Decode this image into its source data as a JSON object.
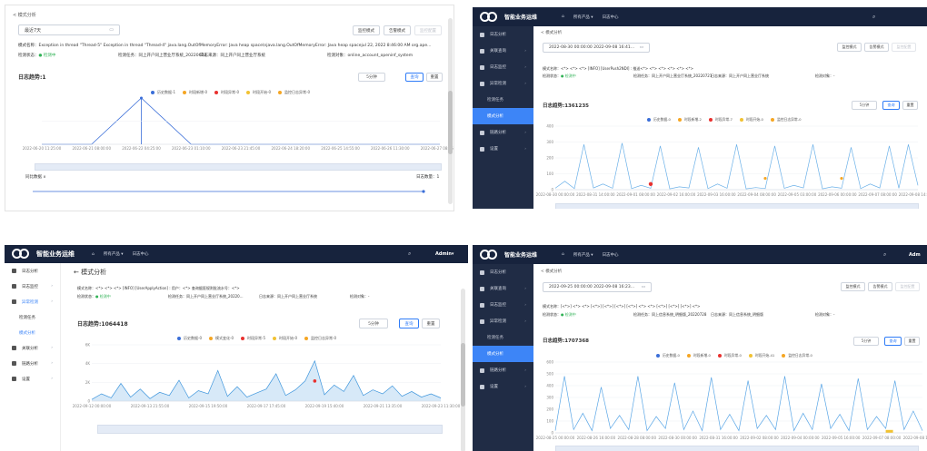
{
  "colors": {
    "bar": "#17233d",
    "side": "#202c45",
    "active": "#3d85f7",
    "line": "#6ab0e8",
    "red": "#e8312f",
    "orange": "#f5a623",
    "lineDark": "#3a8ee6"
  },
  "t1": {
    "back": "< 模式分析",
    "range": "最近7天",
    "btn_mode": "监控模式",
    "btn_err": "告警模式",
    "btn_dis": "监控配置",
    "line1": "模式名称：Exception in thread \"Thread-5\" Exception in thread \"Thread-4\" java.lang.OutOfMemoryError: Java heap space\\njava.lang.OutOfMemoryError: Java heap spacejul 22, 2022 8:46:00 AM org.ape...",
    "line2_status_label": "检测状态：",
    "line2_status": "● 检测中",
    "line2_task": "检测任务：同上开户同上营业厅系统_20220618",
    "line2_src": "日志来源：同上开户同上营业厅系统",
    "line2_db": "检测对象：online_account_openinf_system",
    "count": "日志趋势:1",
    "select": "5分钟",
    "btn_query": "查询",
    "btn_reset": "重置",
    "legend": [
      "历史数据-1",
      "时段新增-0",
      "时段异常-0",
      "时段开始-0",
      "监控日志异常-0"
    ],
    "axis_label": "同比数据 ∧",
    "count2": "日志数量：1",
    "chart_data": {
      "type": "line",
      "x": [
        "2022-06-20 11:25:00",
        "2022-06-21 08:00:00",
        "2022-06-22 04:25:00",
        "2022-06-23 01:10:00",
        "2022-06-23 21:45:00",
        "2022-06-24 18:20:00",
        "2022-06-25 14:55:00",
        "2022-06-26 11:30:00",
        "2022-06-27 08:05:00"
      ],
      "series": [
        {
          "values": [
            0,
            0,
            1,
            0,
            0,
            0,
            0,
            0,
            0
          ]
        }
      ],
      "ylim": [
        0,
        1
      ]
    }
  },
  "t2": {
    "app": "智能业务运维",
    "nav_product": "所有产品 ▾",
    "nav_center": "日志中心",
    "side": [
      "日志分析",
      "关联查询",
      "日志监控",
      "异常检测",
      "检测任务",
      "模式分析",
      "链路分析",
      "设置"
    ],
    "back": "< 模式分析",
    "range": "2022-08-30 00:00:00 2022-09-08 16:41...",
    "btn_mode": "监控模式",
    "btn_err": "告警模式",
    "btn_dis": "监控配置",
    "line1": "模式名称：<*> <*> <*> [INFO] [UserPush2NDI] : 推送<*> <*> <*> <*> <*> <*>",
    "line2_status_label": "检测状态：",
    "line2_status": "● 检测中",
    "line2_task": "检测任务：同上开户同上营业厅系统_20220721",
    "line2_src": "日志来源：同上开户同上营业厅系统",
    "line2_db": "检测对象：-",
    "count": "日志趋势:1361235",
    "select": "5分钟",
    "btn_query": "查询",
    "btn_reset": "重置",
    "legend": [
      "历史数据-0",
      "时段新增-2",
      "时段异常-7",
      "时段开始-0",
      "监控日志异常-0"
    ],
    "chart_data": {
      "type": "line",
      "y_ticks": [
        "400",
        "300",
        "200",
        "100",
        "0"
      ],
      "x_ticks": [
        "2022-08-30 00:00:00",
        "2022-08-31 14:00:00",
        "2022-09-01 08:00:00",
        "2022-09-02 16:00:00",
        "2022-09-03 16:00:00",
        "2022-09-04 08:00:00",
        "2022-09-05 03:00:00",
        "2022-09-06 00:00:00",
        "2022-09-07 08:00:00",
        "2022-09-08 14:00:00"
      ],
      "ylim": [
        0,
        450
      ],
      "series": [
        {
          "values": [
            10,
            60,
            8,
            320,
            12,
            40,
            10,
            330,
            8,
            30,
            10,
            310,
            6,
            20,
            12,
            300,
            8,
            40,
            10,
            320,
            6,
            15,
            8,
            310,
            10,
            30,
            12,
            320,
            6,
            20,
            10,
            300,
            8,
            40,
            12,
            310,
            10,
            320,
            30
          ]
        }
      ]
    }
  },
  "t3": {
    "app": "智能业务运维",
    "nav_product": "所有产品 ▾",
    "nav_center": "日志中心",
    "admin": "Admin▾",
    "side": [
      "日志分析",
      "日志监控",
      "异常检测",
      "检测任务",
      "模式分析",
      "关联分析",
      "链路分析",
      "设置"
    ],
    "back": "← 模式分析",
    "line1": "模式名称：<*> <*> <*> [INFO] [UserApplyAction] : 用户：<*> 查询据医规则批流水号：<*>",
    "line2_status_label": "检测状态：",
    "line2_status": "● 检测中",
    "line2_task": "检测任务：同上开户同上营业厅系统_20220...",
    "line2_src": "日志来源：同上开户同上营业厅系统",
    "line2_db": "检测对象：-",
    "count": "日志趋势:1064418",
    "select": "5分钟",
    "btn_query": "查询",
    "btn_reset": "重置",
    "legend": [
      "历史数据-0",
      "模式变化-0",
      "时段异常-5",
      "时段开始-0",
      "监控日志异常-0"
    ],
    "chart_data": {
      "type": "area",
      "y_ticks": [
        "6K",
        "4K",
        "2K",
        "0"
      ],
      "x_ticks": [
        "2022-09-12 00:00:00",
        "2022-09-13 21:55:00",
        "2022-09-15 19:50:00",
        "2022-09-17 17:45:00",
        "2022-09-19 15:40:00",
        "2022-09-21 13:35:00",
        "2022-09-23 11:30:00"
      ],
      "ylim": [
        0,
        7000
      ],
      "series": [
        {
          "values": [
            200,
            900,
            400,
            2200,
            500,
            1500,
            300,
            1100,
            700,
            2600,
            400,
            1300,
            900,
            3800,
            600,
            1800,
            500,
            1000,
            1500,
            3400,
            700,
            1400,
            2500,
            5000,
            800,
            2000,
            1200,
            3200,
            700,
            1400,
            900,
            1900,
            600,
            1200,
            500,
            900,
            400
          ]
        }
      ]
    }
  },
  "t4": {
    "app": "智能业务运维",
    "nav_product": "所有产品 ▾",
    "nav_center": "日志中心",
    "admin": "Adm",
    "side": [
      "日志分析",
      "关联查询",
      "日志监控",
      "异常检测",
      "检测任务",
      "模式分析",
      "链路分析",
      "设置"
    ],
    "back": "< 模式分析",
    "range": "2022-09-25 00:00:00 2022-09-08 16:23...",
    "btn_mode": "监控模式",
    "btn_err": "告警模式",
    "btn_dis": "监控配置",
    "line1": "模式名称：[<*>] <*> <*> [<*>] [<*>] [<*>] [<*>] <*> <*> [<*>] [<*>] [<*>] <*>",
    "line2_status_label": "检测状态：",
    "line2_status": "● 检测中",
    "line2_task": "检测任务：同上信息系统_明细版_20220728",
    "line2_src": "日志来源：同上信息系统_明细版",
    "line2_db": "检测对象：-",
    "count": "日志趋势:1707368",
    "select": "5分钟",
    "btn_query": "查询",
    "btn_reset": "重置",
    "legend": [
      "历史数据-0",
      "时段新增-0",
      "时段异常-0",
      "时段开始-41",
      "监控日志异常-0"
    ],
    "chart_data": {
      "type": "line",
      "y_ticks": [
        "600",
        "500",
        "400",
        "300",
        "200",
        "100",
        "0"
      ],
      "x_ticks": [
        "2022-08-25 00:00:00",
        "2022-08-26 16:00:00",
        "2022-08-28 08:00:00",
        "2022-08-30 00:00:00",
        "2022-08-31 16:00:00",
        "2022-09-02 08:00:00",
        "2022-09-04 00:00:00",
        "2022-09-05 16:00:00",
        "2022-09-07 08:00:00",
        "2022-09-08 16:00:00"
      ],
      "ylim": [
        0,
        650
      ],
      "series": [
        {
          "values": [
            20,
            520,
            30,
            180,
            20,
            420,
            40,
            160,
            30,
            520,
            20,
            150,
            40,
            460,
            30,
            200,
            20,
            510,
            30,
            170,
            20,
            480,
            40,
            160,
            30,
            520,
            20,
            180,
            30,
            450,
            40,
            170,
            20,
            500,
            30,
            150,
            40,
            480,
            30,
            200,
            20
          ]
        }
      ]
    }
  }
}
